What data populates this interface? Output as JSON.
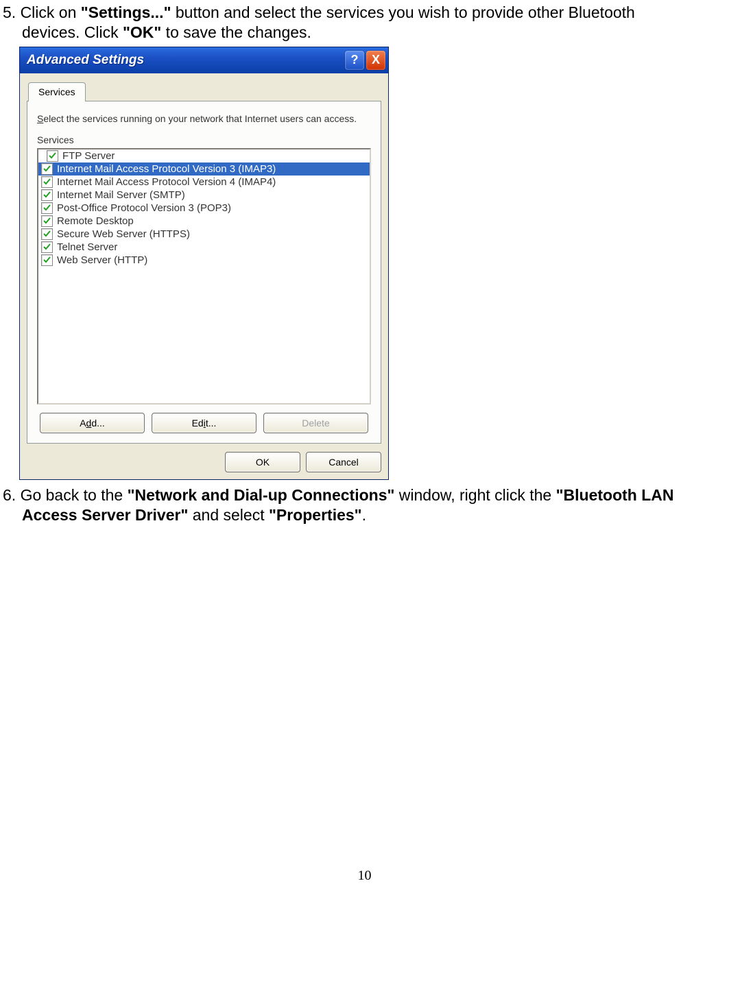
{
  "step5": {
    "prefix": "5. Click on ",
    "bold1": "\"Settings...\"",
    "mid1": " button and select the services you wish to provide other Bluetooth",
    "line2a": "devices. Click ",
    "bold2": "\"OK\"",
    "line2b": " to save the changes."
  },
  "dialog": {
    "title": "Advanced Settings",
    "helpGlyph": "?",
    "closeGlyph": "X",
    "tab": "Services",
    "descA": "S",
    "descB": "elect the services running on your network that Internet users can access.",
    "sublabel": "Services",
    "items": [
      {
        "label": "FTP Server",
        "checked": true,
        "selected": false
      },
      {
        "label": "Internet Mail Access Protocol Version 3 (IMAP3)",
        "checked": true,
        "selected": true
      },
      {
        "label": "Internet Mail Access Protocol Version 4 (IMAP4)",
        "checked": true,
        "selected": false
      },
      {
        "label": "Internet Mail Server (SMTP)",
        "checked": true,
        "selected": false
      },
      {
        "label": "Post-Office Protocol Version 3 (POP3)",
        "checked": true,
        "selected": false
      },
      {
        "label": "Remote Desktop",
        "checked": true,
        "selected": false
      },
      {
        "label": "Secure Web Server (HTTPS)",
        "checked": true,
        "selected": false
      },
      {
        "label": "Telnet Server",
        "checked": true,
        "selected": false
      },
      {
        "label": "Web Server (HTTP)",
        "checked": true,
        "selected": false
      }
    ],
    "buttons": {
      "add_pre": "A",
      "add_u": "d",
      "add_post": "d...",
      "edit_pre": "Ed",
      "edit_u": "i",
      "edit_post": "t...",
      "delete": "Delete",
      "ok": "OK",
      "cancel": "Cancel"
    }
  },
  "step6": {
    "prefix": "6. Go back to the ",
    "bold1": "\"Network and Dial-up Connections\"",
    "mid1": " window, right click the ",
    "bold2": "\"Bluetooth LAN",
    "line2bold": "Access Server Driver\"",
    "line2a": " and select ",
    "bold3": "\"Properties\"",
    "line2b": "."
  },
  "page_number": "10"
}
